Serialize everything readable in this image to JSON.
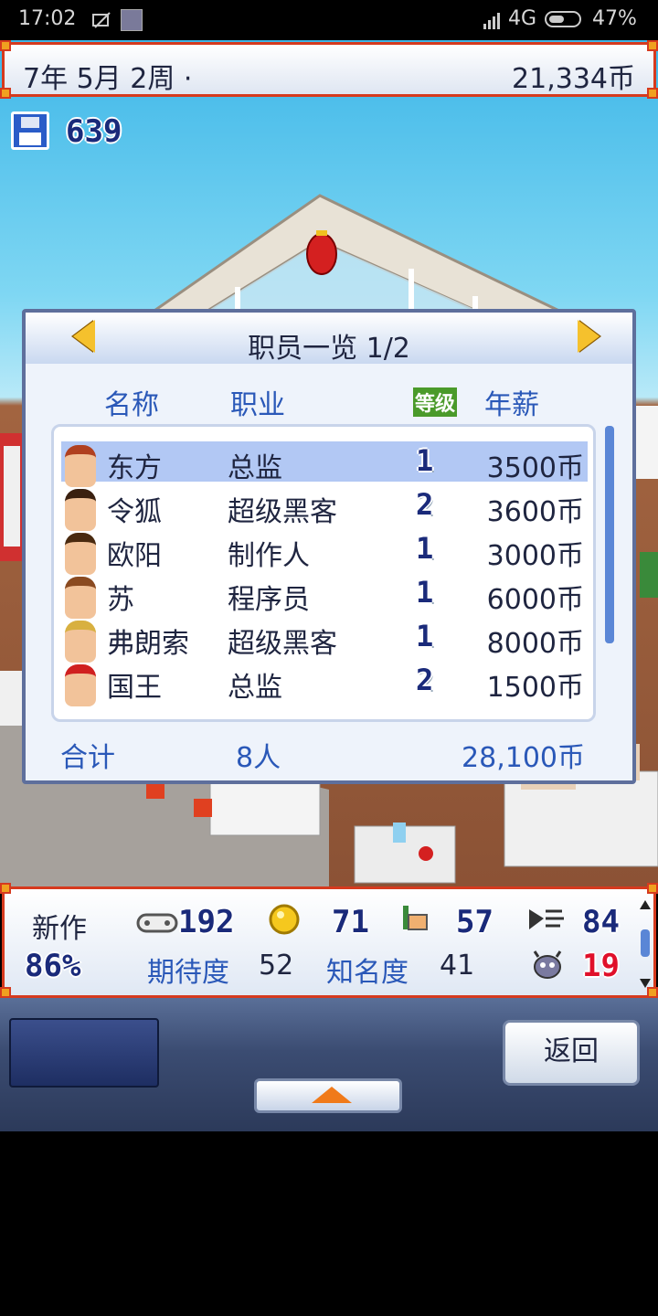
{
  "status_bar": {
    "time": "17:02",
    "network": "4G",
    "battery": "47%"
  },
  "top_bar": {
    "date": "7年 5月 2周 ·",
    "money": "21,334币"
  },
  "save": {
    "count": "639"
  },
  "staff_dialog": {
    "title": "职员一览 1/2",
    "columns": {
      "name": "名称",
      "job": "职业",
      "level": "等级",
      "salary": "年薪"
    },
    "rows": [
      {
        "name": "东方",
        "job": "总监",
        "level": "1",
        "salary": "3500币",
        "selected": true
      },
      {
        "name": "令狐",
        "job": "超级黑客",
        "level": "2",
        "salary": "3600币"
      },
      {
        "name": "欧阳",
        "job": "制作人",
        "level": "1",
        "salary": "3000币"
      },
      {
        "name": "苏",
        "job": "程序员",
        "level": "1",
        "salary": "6000币"
      },
      {
        "name": "弗朗索",
        "job": "超级黑客",
        "level": "1",
        "salary": "8000币"
      },
      {
        "name": "国王",
        "job": "总监",
        "level": "2",
        "salary": "1500币"
      }
    ],
    "total": {
      "label": "合计",
      "count": "8人",
      "salary": "28,100币"
    }
  },
  "stats": {
    "new_label": "新作",
    "progress": "86%",
    "controller_value": "192",
    "coin_value": "71",
    "paint_value": "57",
    "sound_value": "84",
    "bug_value": "19",
    "expectation_label": "期待度",
    "expectation_value": "52",
    "fame_label": "知名度",
    "fame_value": "41"
  },
  "nav": {
    "back_label": "返回"
  },
  "colors": {
    "accent_red": "#d63a1e",
    "text_blue": "#2a58b8",
    "selected_row": "#b2c8f4",
    "bug_red": "#e0102a"
  }
}
